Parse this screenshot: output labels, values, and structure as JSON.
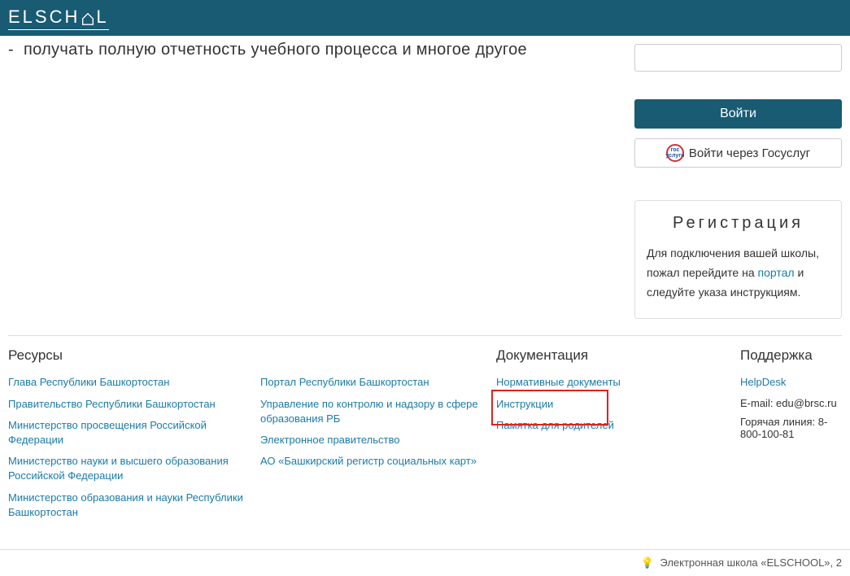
{
  "logo": {
    "prefix": "ELSCH",
    "suffix": "L"
  },
  "hero_line": "получать полную отчетность учебного процесса и многое другое",
  "login": {
    "button": "Войти",
    "gos_button": "Войти через Госуслуг",
    "gos_icon_text": "гос услуги"
  },
  "registration": {
    "title": "Регистрация",
    "text_before": "Для подключения вашей школы, пожал перейдите на ",
    "portal_link": "портал",
    "text_after": " и следуйте указа инструкциям."
  },
  "footer": {
    "resources": {
      "title": "Ресурсы",
      "links_a": [
        "Глава Республики Башкортостан",
        "Правительство Республики Башкортостан",
        "Министерство просвещения Российской Федерации",
        "Министерство науки и высшего образования Российской Федерации",
        "Министерство образования и науки Республики Башкортостан"
      ],
      "links_b": [
        "Портал Республики Башкортостан",
        "Управление по контролю и надзору в сфере образования РБ",
        "Электронное правительство",
        "АО «Башкирский регистр социальных карт»"
      ]
    },
    "docs": {
      "title": "Документация",
      "links": [
        "Нормативные документы",
        "Инструкции",
        "Памятка для родителей"
      ]
    },
    "support": {
      "title": "Поддержка",
      "helpdesk": "HelpDesk",
      "email": "E-mail: edu@brsc.ru",
      "hotline": "Горячая линия: 8-800-100-81"
    }
  },
  "bottom": "Электронная школа «ELSCHOOL», 2"
}
